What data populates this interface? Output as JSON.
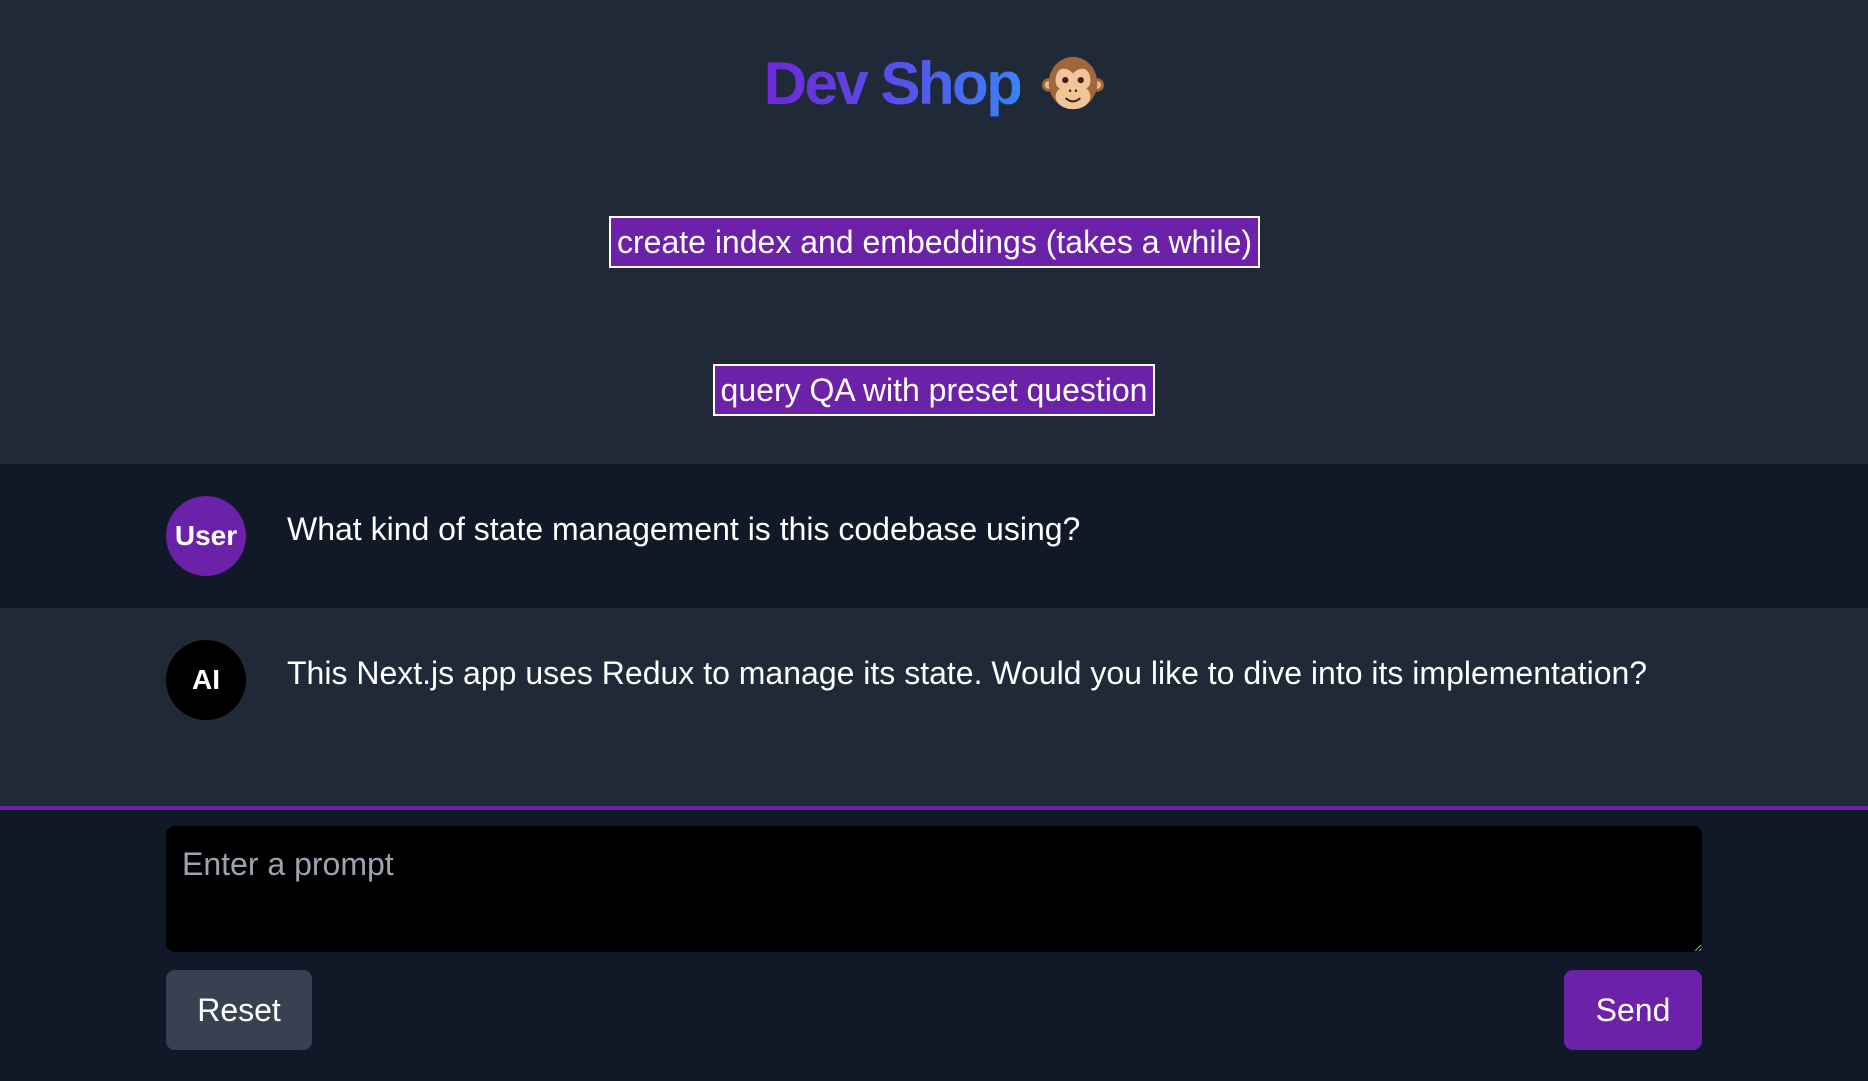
{
  "header": {
    "title": "Dev Shop",
    "emoji_icon": "monkey-face-icon"
  },
  "actions": {
    "create_index_label": "create index and embeddings (takes a while)",
    "query_qa_label": "query QA with preset question"
  },
  "messages": [
    {
      "role": "User",
      "avatar_label": "User",
      "text": "What kind of state management is this codebase using?"
    },
    {
      "role": "AI",
      "avatar_label": "AI",
      "text": "This Next.js app uses Redux to manage its state. Would you like to dive into its implementation?"
    }
  ],
  "composer": {
    "placeholder": "Enter a prompt",
    "value": "",
    "reset_label": "Reset",
    "send_label": "Send"
  },
  "colors": {
    "accent_purple": "#6b21a8",
    "title_gradient_start": "#6d28d9",
    "title_gradient_end": "#3b82f6",
    "background": "#1f2937",
    "background_dark": "#111827"
  }
}
